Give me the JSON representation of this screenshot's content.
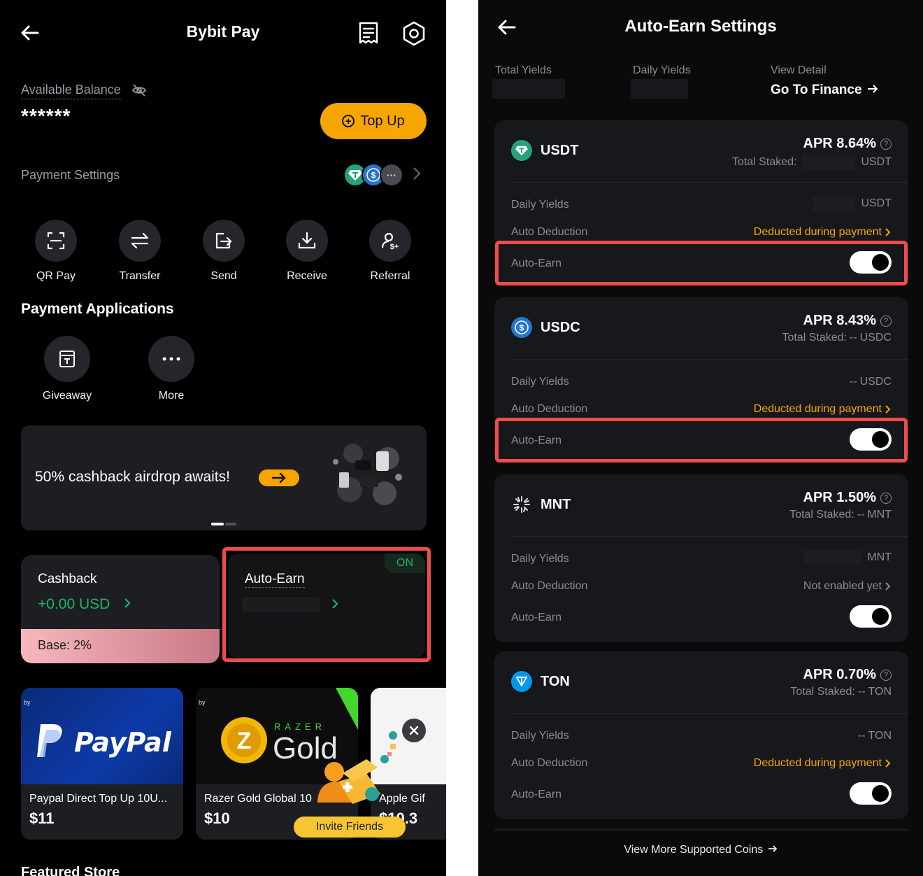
{
  "left": {
    "title": "Bybit Pay",
    "icons": {
      "back": "back-arrow-icon",
      "receipt": "receipt-icon",
      "settings": "settings-icon",
      "eye_off": "eye-off-icon"
    },
    "available_balance_label": "Available Balance",
    "balance_masked": "******",
    "top_up_label": "Top Up",
    "payment_settings_label": "Payment Settings",
    "quick_actions": [
      {
        "label": "QR Pay",
        "icon": "qr-scan-icon"
      },
      {
        "label": "Transfer",
        "icon": "transfer-icon"
      },
      {
        "label": "Send",
        "icon": "send-icon"
      },
      {
        "label": "Receive",
        "icon": "receive-icon"
      },
      {
        "label": "Referral",
        "icon": "referral-icon"
      }
    ],
    "payment_applications_title": "Payment Applications",
    "payment_applications": [
      {
        "label": "Giveaway",
        "icon": "giveaway-icon"
      },
      {
        "label": "More",
        "icon": "more-icon"
      }
    ],
    "banner_text": "50% cashback airdrop awaits!",
    "cashback": {
      "title": "Cashback",
      "value": "+0.00 USD",
      "base": "Base: 2%"
    },
    "auto_earn": {
      "title": "Auto-Earn",
      "status": "ON"
    },
    "gift_cards": [
      {
        "name": "Paypal Direct Top Up 10U...",
        "price": "$11",
        "brand": "PayPal",
        "by": "by"
      },
      {
        "name": "Razer Gold Global 10",
        "price": "$10",
        "brand": "RAZER",
        "brand2": "Gold",
        "by": "by"
      },
      {
        "name": "Apple Gif",
        "price": "$10.3"
      }
    ],
    "invite_friends": "Invite Friends",
    "featured_store": "Featured Store",
    "colors": {
      "accent": "#f7a600",
      "green": "#20b26c",
      "highlight": "#ef4d4d"
    }
  },
  "right": {
    "title": "Auto-Earn Settings",
    "total_yields_label": "Total Yields",
    "daily_yields_label": "Daily Yields",
    "view_detail_label": "View Detail",
    "go_to_finance": "Go To Finance",
    "coins": [
      {
        "name": "USDT",
        "apr": "APR 8.64%",
        "staked_label": "Total Staked:",
        "staked_value": "",
        "staked_unit": "USDT",
        "daily_label": "Daily Yields",
        "daily_value": "",
        "daily_unit": "USDT",
        "deduction_label": "Auto Deduction",
        "deduction_value": "Deducted during payment",
        "auto_earn_label": "Auto-Earn",
        "auto_earn_on": true
      },
      {
        "name": "USDC",
        "apr": "APR 8.43%",
        "staked_label": "Total Staked:",
        "staked_value": "--",
        "staked_unit": "USDC",
        "daily_label": "Daily Yields",
        "daily_value": "--",
        "daily_unit": "USDC",
        "deduction_label": "Auto Deduction",
        "deduction_value": "Deducted during payment",
        "auto_earn_label": "Auto-Earn",
        "auto_earn_on": true
      },
      {
        "name": "MNT",
        "apr": "APR 1.50%",
        "staked_label": "Total Staked:",
        "staked_value": "--",
        "staked_unit": "MNT",
        "daily_label": "Daily Yields",
        "daily_value": "",
        "daily_unit": "MNT",
        "deduction_label": "Auto Deduction",
        "deduction_value": "Not enabled yet",
        "auto_earn_label": "Auto-Earn",
        "auto_earn_on": true
      },
      {
        "name": "TON",
        "apr": "APR 0.70%",
        "staked_label": "Total Staked:",
        "staked_value": "--",
        "staked_unit": "TON",
        "daily_label": "Daily Yields",
        "daily_value": "--",
        "daily_unit": "TON",
        "deduction_label": "Auto Deduction",
        "deduction_value": "Deducted during payment",
        "auto_earn_label": "Auto-Earn",
        "auto_earn_on": true
      }
    ],
    "view_more": "View More Supported Coins"
  }
}
